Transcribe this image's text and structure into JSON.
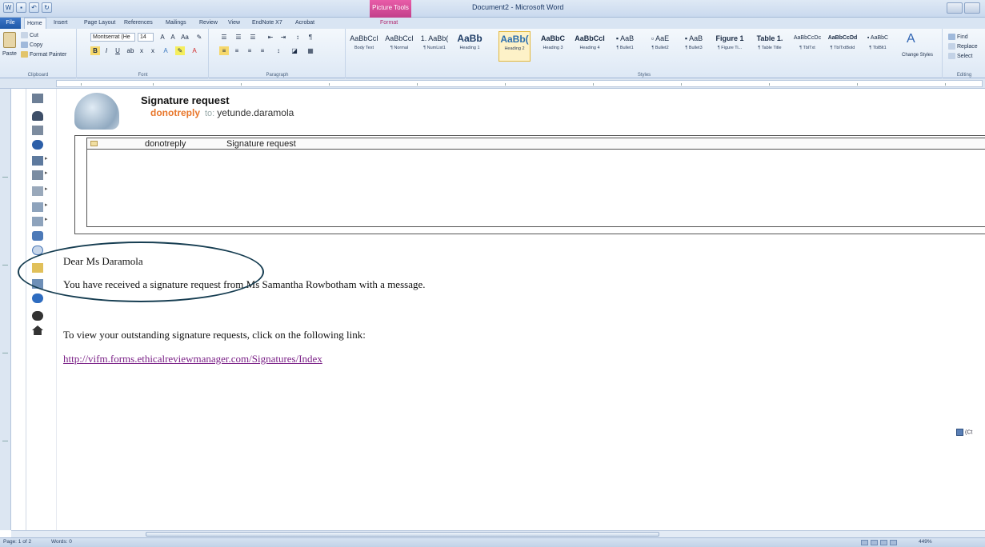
{
  "window": {
    "title": "Document2 - Microsoft Word",
    "context_tab": "Picture Tools"
  },
  "tabs": [
    {
      "label": "File"
    },
    {
      "label": "Home"
    },
    {
      "label": "Insert"
    },
    {
      "label": "Page Layout"
    },
    {
      "label": "References"
    },
    {
      "label": "Mailings"
    },
    {
      "label": "Review"
    },
    {
      "label": "View"
    },
    {
      "label": "EndNote X7"
    },
    {
      "label": "Acrobat"
    },
    {
      "label": "Format"
    }
  ],
  "ribbon": {
    "clipboard": {
      "label": "Clipboard",
      "paste": "Paste",
      "cut": "Cut",
      "copy": "Copy",
      "format_painter": "Format Painter"
    },
    "font": {
      "label": "Font",
      "font_name": "Montserrat (He",
      "font_size": "14"
    },
    "paragraph": {
      "label": "Paragraph"
    },
    "styles": {
      "label": "Styles",
      "items": [
        {
          "preview": "AaBbCcI",
          "name": "Body Text"
        },
        {
          "preview": "AaBbCcI",
          "name": "¶ Normal"
        },
        {
          "preview": "1. AaBb(",
          "name": "¶ NumList1"
        },
        {
          "preview": "AaBb",
          "name": "Heading 1"
        },
        {
          "preview": "AaBb(",
          "name": "Heading 2"
        },
        {
          "preview": "AaBbC",
          "name": "Heading 3"
        },
        {
          "preview": "AaBbCcI",
          "name": "Heading 4"
        },
        {
          "preview": "▪ AaB",
          "name": "¶ Bullet1"
        },
        {
          "preview": "▫ AaE",
          "name": "¶ Bullet2"
        },
        {
          "preview": "▪ AaB",
          "name": "¶ Bullet3"
        },
        {
          "preview": "Figure 1",
          "name": "¶ Figure Ti..."
        },
        {
          "preview": "Table 1.",
          "name": "¶ Table Title"
        },
        {
          "preview": "AaBbCcDc",
          "name": "¶ TblTxt"
        },
        {
          "preview": "AaBbCcDd",
          "name": "¶ TblTxtBold"
        },
        {
          "preview": "▪ AaBbC",
          "name": "¶ TblBlt1"
        }
      ],
      "selected_index": 4,
      "change_styles": "Change Styles"
    },
    "editing": {
      "label": "Editing",
      "find": "Find",
      "replace": "Replace",
      "select": "Select"
    }
  },
  "email": {
    "subject": "Signature request",
    "sender": "donotreply",
    "to_label": "to:",
    "recipient": "yetunde.daramola",
    "table_row": {
      "from": "donotreply",
      "subject": "Signature request"
    }
  },
  "body": {
    "greeting": "Dear  Ms Daramola",
    "line1": "You have received a signature request from  Ms Samantha Rowbotham with a message.",
    "line2": "To view your outstanding signature requests, click on the following link:",
    "link": "http://vifm.forms.ethicalreviewmanager.com/Signatures/Index"
  },
  "status": {
    "page": "Page: 1 of 2",
    "words": "Words: 0",
    "zoom": "449%"
  },
  "colors": {
    "sender": "#e8762a",
    "link": "#7a1f86",
    "annotation_ellipse": "#173e52"
  }
}
